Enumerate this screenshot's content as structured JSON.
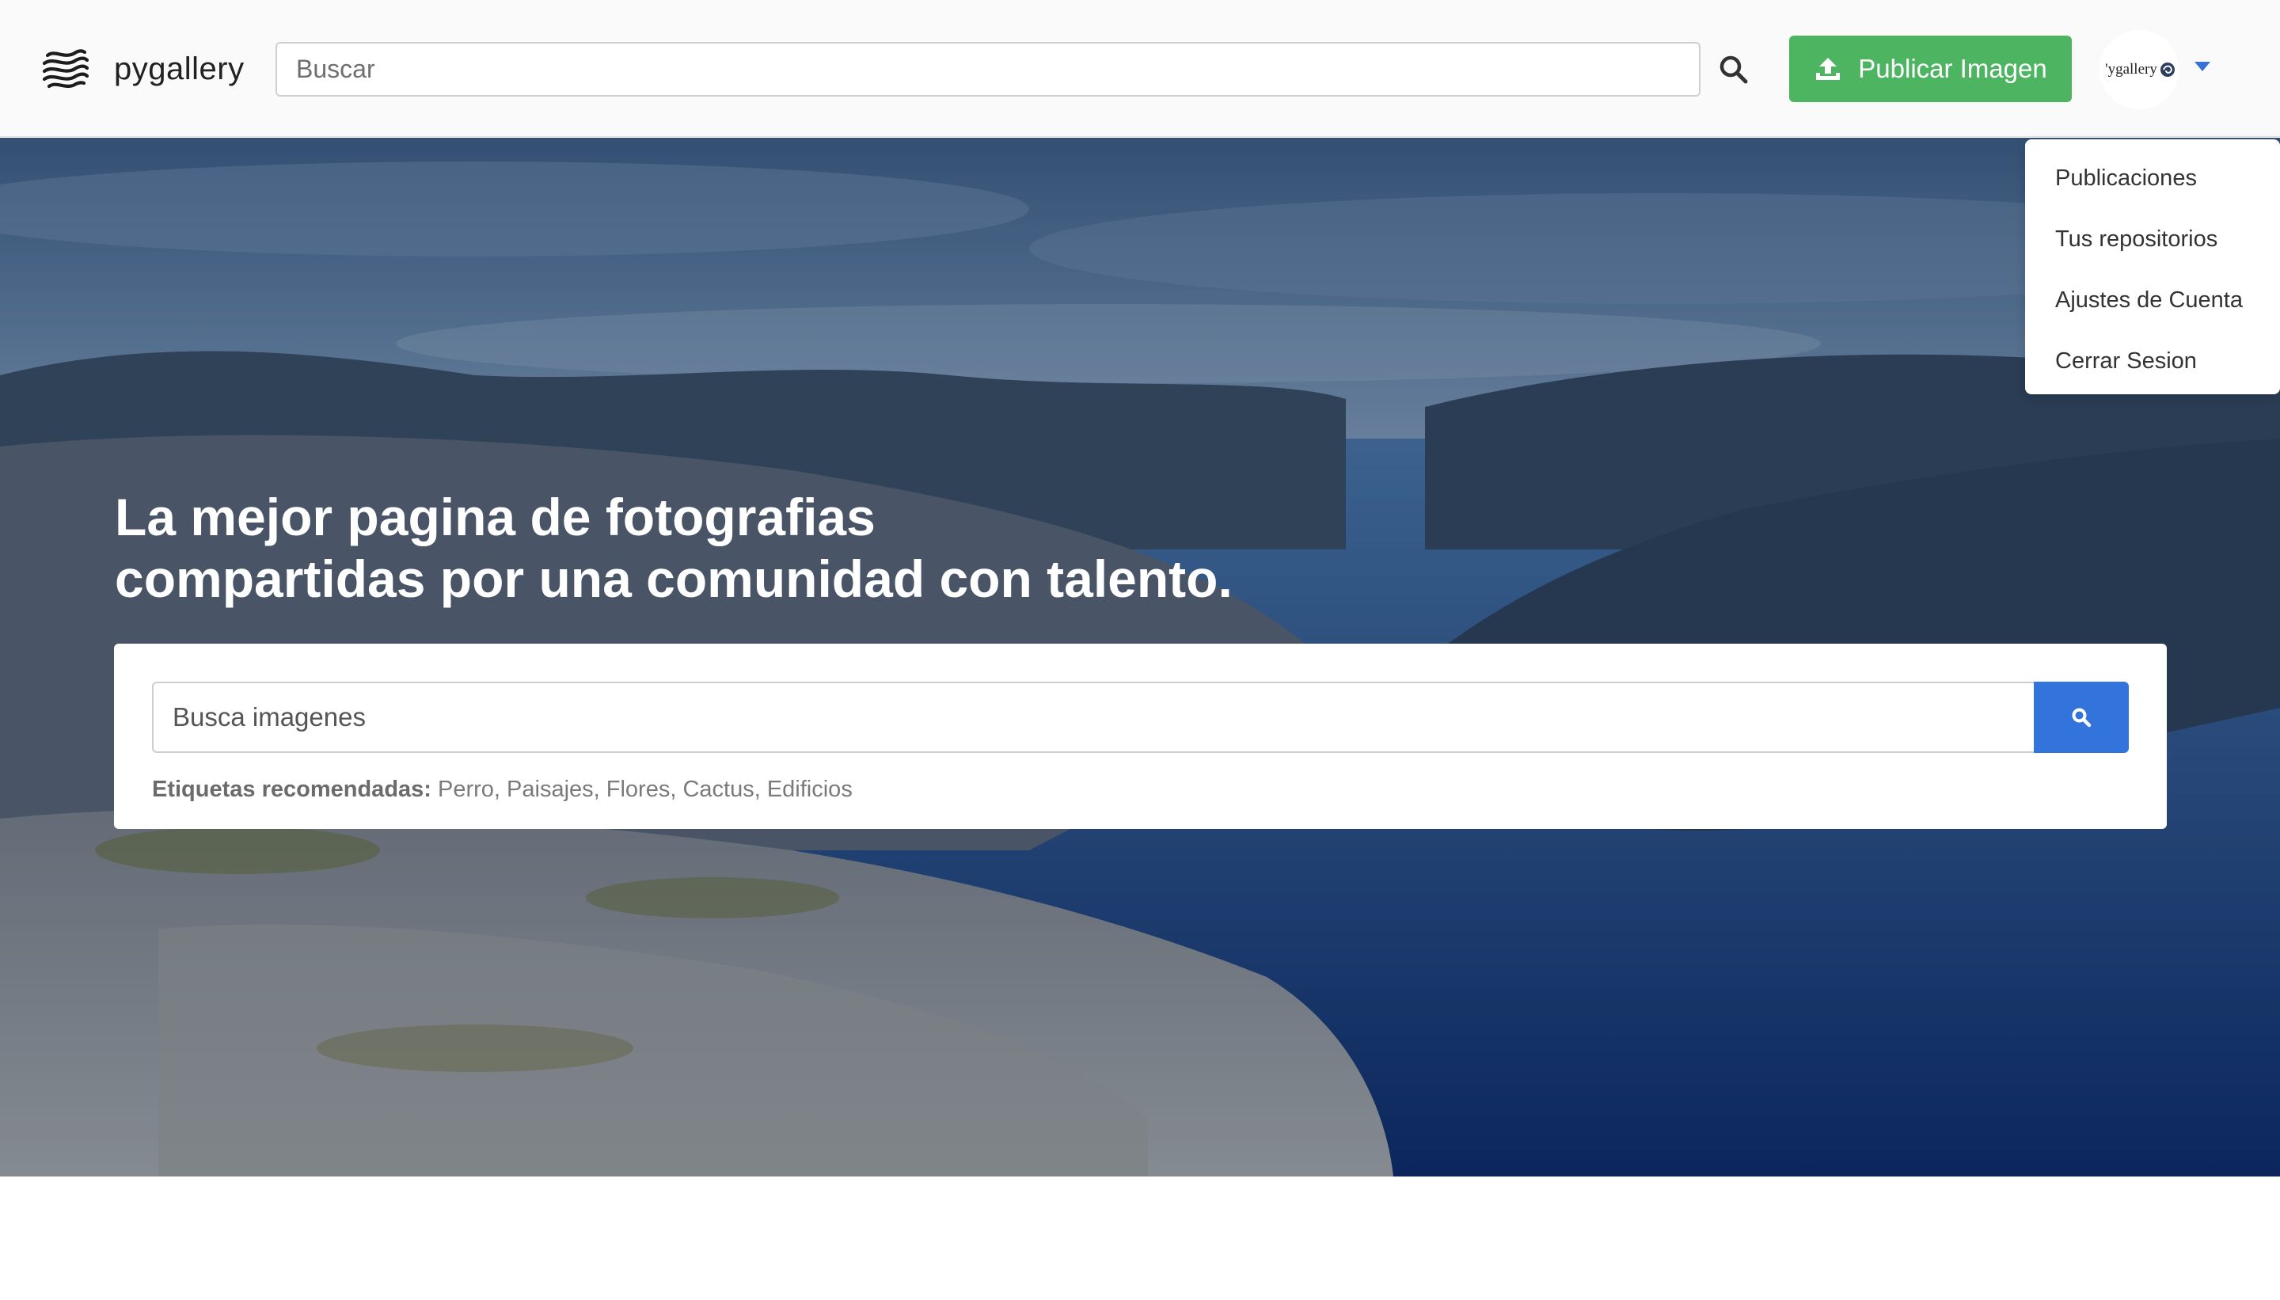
{
  "navbar": {
    "brand_name": "pygallery",
    "search_placeholder": "Buscar",
    "publish_label": "Publicar Imagen",
    "avatar_text": "'ygallery"
  },
  "hero": {
    "title_line1": "La mejor pagina de fotografias",
    "title_line2": "compartidas por una comunidad con talento.",
    "search_placeholder": "Busca imagenes",
    "tags_label": "Etiquetas recomendadas:",
    "tags": "Perro, Paisajes, Flores, Cactus, Edificios"
  },
  "dropdown": {
    "items": [
      "Publicaciones",
      "Tus repositorios",
      "Ajustes de Cuenta",
      "Cerrar Sesion"
    ]
  },
  "colors": {
    "publish_green": "#4db461",
    "search_blue": "#3273dc",
    "caret_blue": "#3a6fd8"
  },
  "icons": {
    "brand": "wave-logo-icon",
    "nav_search": "search-icon",
    "publish": "upload-icon",
    "hero_search": "search-icon",
    "dropdown_toggle": "caret-down-icon"
  }
}
